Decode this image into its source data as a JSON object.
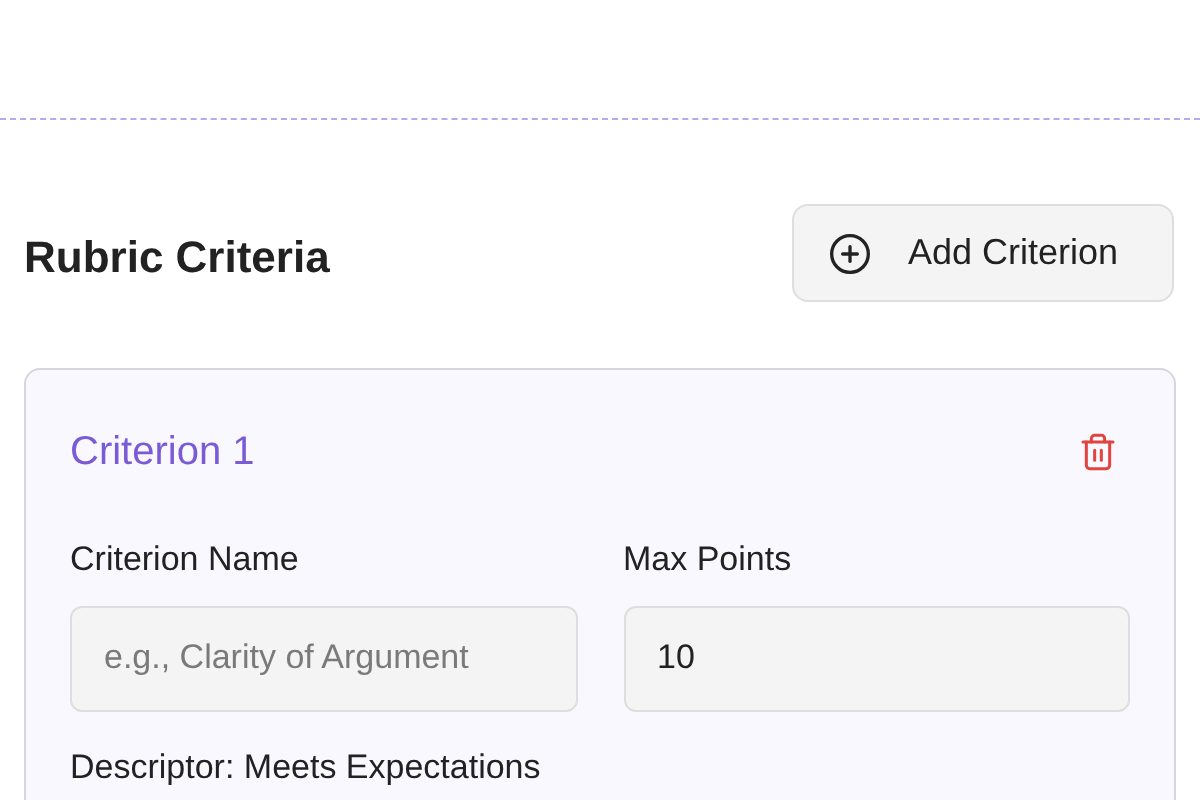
{
  "section": {
    "title": "Rubric Criteria",
    "add_button": "Add Criterion"
  },
  "criteria": [
    {
      "title": "Criterion 1",
      "fields": [
        {
          "label": "Criterion Name",
          "placeholder": "e.g., Clarity of Argument"
        },
        {
          "label": "Max Points",
          "value": "10"
        }
      ],
      "next_label": "Descriptor: Meets Expectations"
    }
  ]
}
